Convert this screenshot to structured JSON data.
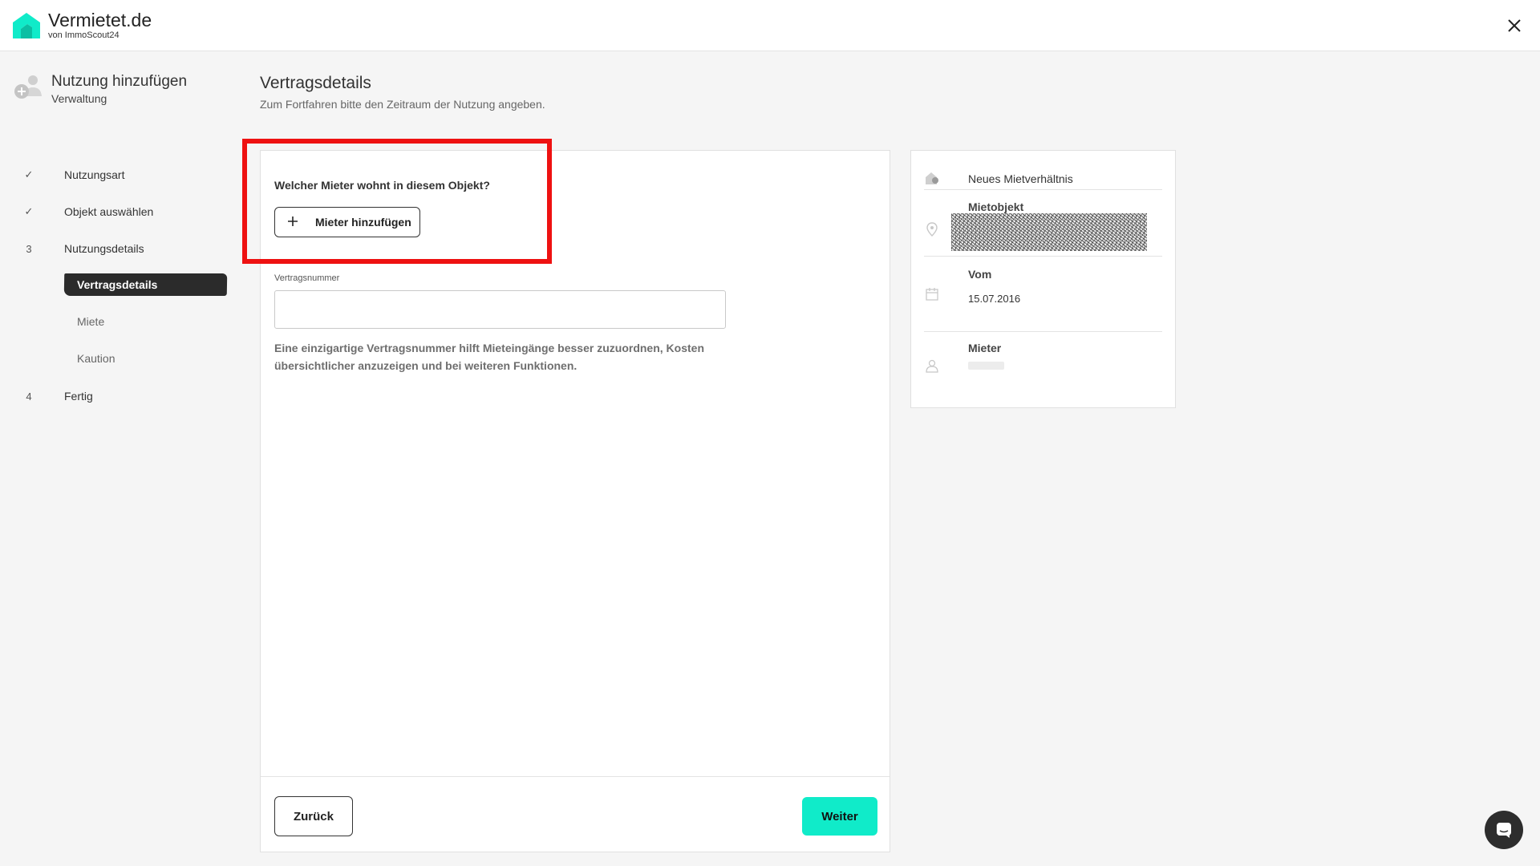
{
  "header": {
    "brand_name": "Vermietet.de",
    "brand_sub": "von ImmoScout24",
    "logo_icon": "house-logo-icon",
    "close_icon": "close-icon"
  },
  "sidebar": {
    "title": "Nutzung hinzufügen",
    "subtitle": "Verwaltung",
    "steps": [
      {
        "marker": "✓",
        "label": "Nutzungsart",
        "state": "done"
      },
      {
        "marker": "✓",
        "label": "Objekt auswählen",
        "state": "done"
      },
      {
        "marker": "3",
        "label": "Nutzungsdetails",
        "state": "current"
      },
      {
        "marker": "4",
        "label": "Fertig",
        "state": "todo"
      }
    ],
    "substeps": [
      {
        "label": "Vertragsdetails",
        "active": true
      },
      {
        "label": "Miete",
        "active": false
      },
      {
        "label": "Kaution",
        "active": false
      }
    ]
  },
  "main": {
    "title": "Vertragsdetails",
    "subtitle": "Zum Fortfahren bitte den Zeitraum der Nutzung angeben.",
    "tenant_question": "Welcher Mieter wohnt in diesem Objekt?",
    "add_tenant_label": "Mieter hinzufügen",
    "contract_number_label": "Vertragsnummer",
    "contract_number_value": "",
    "hint": "Eine einzigartige Vertragsnummer hilft Mieteingänge besser zuzuordnen, Kosten übersichtlicher anzuzeigen und bei weiteren Funktionen.",
    "back_label": "Zurück",
    "next_label": "Weiter"
  },
  "summary": {
    "new_tenancy": "Neues Mietverhältnis",
    "rental_object_label": "Mietobjekt",
    "from_label": "Vom",
    "from_value": "15.07.2016",
    "tenant_label": "Mieter"
  },
  "colors": {
    "accent": "#10ebc9",
    "highlight": "#ee1111",
    "active_step_bg": "#2b2b2b"
  }
}
